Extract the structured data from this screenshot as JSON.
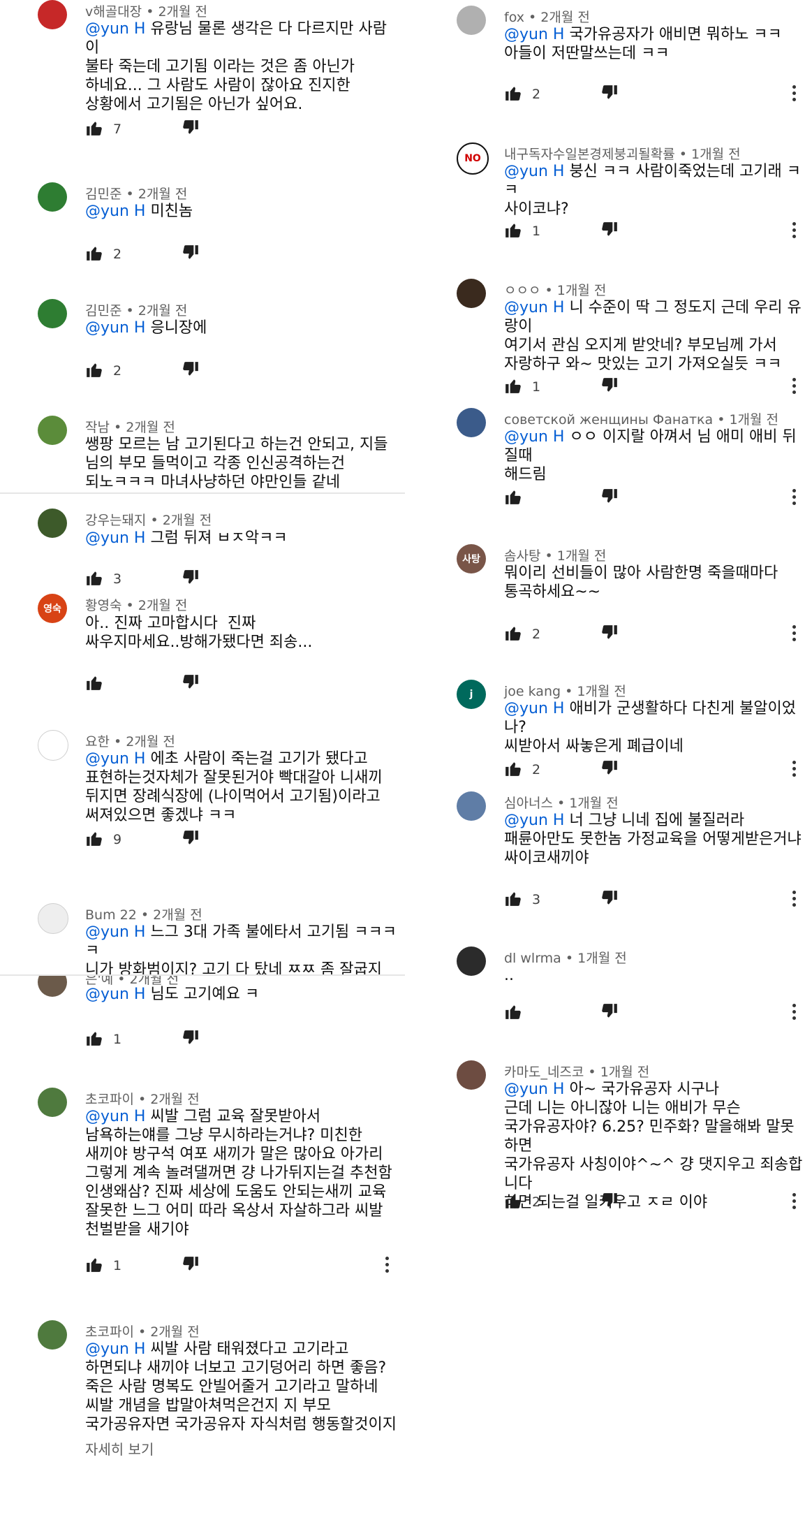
{
  "mention": "@yun H",
  "read_more": "자세히 보기",
  "left_comments": [
    {
      "author": "v해골대장",
      "time": "2개월 전",
      "mention": true,
      "text": " 유랑님 물론 생각은 다 다르지만 사람이\n불타 죽는데 고기됨 이라는 것은 좀 아닌가\n하네요... 그 사람도 사람이 잖아요 진지한\n상황에서 고기됨은 아닌가 싶어요.",
      "likes": "7",
      "avatar": {
        "color": "#c62828",
        "label": ""
      }
    },
    {
      "author": "김민준",
      "time": "2개월 전",
      "mention": true,
      "text": " 미친놈",
      "likes": "2",
      "avatar": {
        "color": "#2e7d32",
        "label": ""
      }
    },
    {
      "author": "김민준",
      "time": "2개월 전",
      "mention": true,
      "text": " 응니장에",
      "likes": "2",
      "avatar": {
        "color": "#2e7d32",
        "label": ""
      }
    },
    {
      "author": "작남",
      "time": "2개월 전",
      "mention": false,
      "text": "쌩팡 모르는 남 고기된다고 하는건 안되고, 지들\n님의 부모 들먹이고 각종 인신공격하는건\n되노ㅋㅋㅋ 마녀사냥하던 야만인들 같네",
      "likes": "",
      "avatar": {
        "color": "#5b8c3a",
        "label": ""
      }
    },
    {
      "author": "강우는돼지",
      "time": "2개월 전",
      "mention": true,
      "text": " 그럼 뒤져 ㅂㅈ악ㅋㅋ",
      "likes": "3",
      "avatar": {
        "color": "#3d5a2a",
        "label": ""
      }
    },
    {
      "author": "황영숙",
      "time": "2개월 전",
      "mention": false,
      "text": "아.. 진짜 고마합시다  진짜\n싸우지마세요..방해가됐다면 죄송...",
      "likes": "",
      "avatar": {
        "color": "#d84315",
        "label": "영숙"
      }
    },
    {
      "author": "요한",
      "time": "2개월 전",
      "mention": true,
      "text": " 에초 사람이 죽는걸 고기가 됐다고\n표현하는것자체가 잘못된거야 빡대갈아 니새끼\n뒤지면 장례식장에 (나이먹어서 고기됨)이라고\n써져있으면 좋겠냐 ㅋㅋ",
      "likes": "9",
      "avatar": {
        "color": "#ffffff",
        "label": ""
      }
    },
    {
      "author": "Bum 22",
      "time": "2개월 전",
      "mention": true,
      "text": " 느그 3대 가족 불에타서 고기됨 ㅋㅋㅋㅋ\n니가 방화범이지? 고기 다 탔네 ㅉㅉ 좀 잘굽지",
      "likes": "",
      "avatar": {
        "color": "#eeeeee",
        "label": ""
      }
    },
    {
      "author": "은'예",
      "time": "2개월 전",
      "mention": true,
      "text": " 님도 고기예요 ㅋ",
      "likes": "1",
      "avatar": {
        "color": "#6b5a4a",
        "label": ""
      }
    },
    {
      "author": "초코파이",
      "time": "2개월 전",
      "mention": true,
      "text": " 씨발 그럼 교육 잘못받아서\n남욕하는얘를 그냥 무시하라는거냐? 미친한\n새끼야 방구석 여포 새끼가 말은 많아요 아가리\n그렇게 계속 놀려댈꺼면 걍 나가뒤지는걸 추천함\n인생왜삼? 진짜 세상에 도움도 안되는새끼 교육\n잘못한 느그 어미 따라 옥상서 자살하그라 씨발\n천벌받을 새기야",
      "likes": "1",
      "avatar": {
        "color": "#4f7a3e",
        "label": ""
      }
    },
    {
      "author": "초코파이",
      "time": "2개월 전",
      "mention": true,
      "text": " 씨발 사람 태워졌다고 고기라고\n하면되냐 새끼야 너보고 고기덩어리 하면 좋음?\n죽은 사람 명복도 안빌어줄거 고기라고 말하네\n씨발 개념을 밥말아쳐먹은건지 지 부모\n국가공유자면 국가공유자 자식처럼 행동할것이지",
      "likes": "",
      "avatar": {
        "color": "#4f7a3e",
        "label": ""
      }
    }
  ],
  "right_comments": [
    {
      "author": "fox",
      "time": "2개월 전",
      "mention": true,
      "text": " 국가유공자가 애비면 뭐하노 ㅋㅋ\n아들이 저딴말쓰는데 ㅋㅋ",
      "likes": "2",
      "avatar": {
        "color": "#b0b0b0",
        "label": ""
      }
    },
    {
      "author": "내구독자수일본경제붕괴될확률",
      "time": "1개월 전",
      "mention": true,
      "text": " 붕신 ㅋㅋ 사람이죽었는데 고기래 ㅋㅋ\n사이코냐?",
      "likes": "1",
      "avatar": {
        "color": "#111111",
        "label": "NO"
      }
    },
    {
      "author": "ㅇㅇㅇ",
      "time": "1개월 전",
      "mention": true,
      "text": " 니 수준이 딱 그 정도지 근데 우리 유랑이\n여기서 관심 오지게 받앗네? 부모님께 가서\n자랑하구 와~ 맛있는 고기 가져오실듯 ㅋㅋ",
      "likes": "1",
      "avatar": {
        "color": "#3a2a1e",
        "label": ""
      }
    },
    {
      "author": "советской женщины Фанатка",
      "time": "1개월 전",
      "mention": true,
      "text": " ㅇㅇ 이지랄 아껴서 님 애미 애비 뒤질때\n해드림",
      "likes": "",
      "avatar": {
        "color": "#3b5b8a",
        "label": ""
      }
    },
    {
      "author": "솜사탕",
      "time": "1개월 전",
      "mention": false,
      "text": "뭐이리 선비들이 많아 사람한명 죽을때마다\n통곡하세요~~",
      "likes": "2",
      "avatar": {
        "color": "#795548",
        "label": "사탕"
      }
    },
    {
      "author": "joe kang",
      "time": "1개월 전",
      "mention": true,
      "text": " 애비가 군생활하다 다친게 불알이었나?\n씨받아서 싸놓은게 폐급이네",
      "likes": "2",
      "avatar": {
        "color": "#00695c",
        "label": "j"
      }
    },
    {
      "author": "심아너스",
      "time": "1개월 전",
      "mention": true,
      "text": " 너 그냥 니네 집에 불질러라\n패륜아만도 못한놈 가정교육을 어떻게받은거냐\n싸이코새끼야",
      "likes": "3",
      "avatar": {
        "color": "#5f7da6",
        "label": ""
      }
    },
    {
      "author": "dl wlrma",
      "time": "1개월 전",
      "mention": false,
      "text": "..",
      "likes": "",
      "avatar": {
        "color": "#2b2b2b",
        "label": ""
      }
    },
    {
      "author": "카마도_네즈코",
      "time": "1개월 전",
      "mention": true,
      "text": " 아~ 국가유공자 시구나\n근데 니는 아니잖아 니는 애비가 무슨\n국가유공자야? 6.25? 민주화? 말을해봐 말못하면\n국가유공자 사칭이야^~^ 걍 댓지우고 죄송합니다\n하면 되는걸 일키우고 ㅈㄹ 이야",
      "likes": "2",
      "avatar": {
        "color": "#6d4c41",
        "label": ""
      }
    }
  ]
}
